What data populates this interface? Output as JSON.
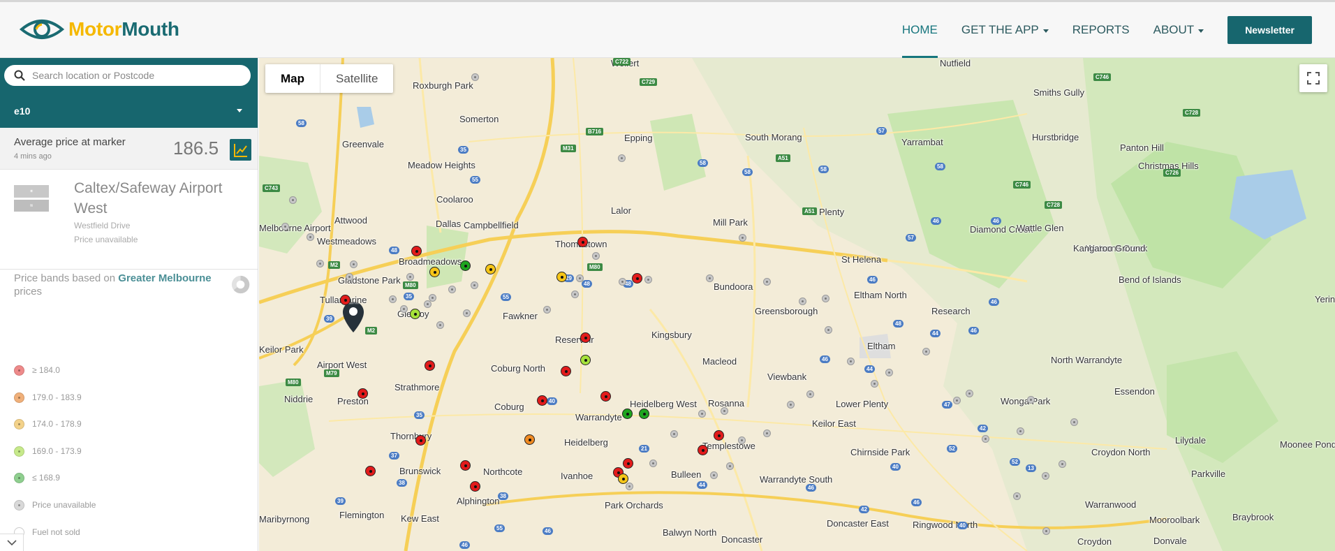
{
  "header": {
    "logo_motor": "Motor",
    "logo_mouth": "Mouth",
    "nav": [
      {
        "label": "HOME",
        "has_caret": false,
        "active": true
      },
      {
        "label": "GET THE APP",
        "has_caret": true,
        "active": false
      },
      {
        "label": "REPORTS",
        "has_caret": false,
        "active": false
      },
      {
        "label": "ABOUT",
        "has_caret": true,
        "active": false
      }
    ],
    "newsletter_label": "Newsletter"
  },
  "sidebar": {
    "search_placeholder": "Search location or Postcode",
    "fuel_type": "e10",
    "avg_label": "Average price at marker",
    "avg_time": "4 mins ago",
    "avg_price": "186.5",
    "station": {
      "name": "Caltex/Safeway Airport West",
      "address": "Westfield Drive",
      "status": "Price unavailable"
    },
    "bands_prefix": "Price bands based on",
    "bands_city": "Greater Melbourne",
    "bands_suffix": "prices",
    "legend": [
      {
        "label": "≥ 184.0",
        "color": "#ee8a8a"
      },
      {
        "label": "179.0 - 183.9",
        "color": "#f0b07a"
      },
      {
        "label": "174.0 - 178.9",
        "color": "#f3d28a"
      },
      {
        "label": "169.0 - 173.9",
        "color": "#c6e98a"
      },
      {
        "label": "≤ 168.9",
        "color": "#8fcf8f"
      },
      {
        "label": "Price unavailable",
        "color": "#d9d9d9"
      },
      {
        "label": "Fuel not sold",
        "color": "#ffffff"
      }
    ]
  },
  "map": {
    "toggle_map": "Map",
    "toggle_satellite": "Satellite",
    "colors": {
      "red": "#e21b1b",
      "orange": "#ef8a22",
      "yellow": "#f5c518",
      "lime": "#a6e23a",
      "green": "#1fa51f"
    },
    "places": [
      "Wollert",
      "Nutfield",
      "Roxburgh Park",
      "Somerton",
      "Smiths Gully",
      "Greenvale",
      "Epping",
      "South Morang",
      "Yarrambat",
      "Hurstbridge",
      "Panton Hill",
      "Christmas Hills",
      "Meadow Heights",
      "Coolaroo",
      "Dallas",
      "Campbellfield",
      "Lalor",
      "Mill Park",
      "Plenty",
      "Diamond Creek",
      "Wattle Glen",
      "Watsons Creek",
      "Melbourne Airport",
      "Attwood",
      "Westmeadows",
      "Thomastown",
      "Broadmeadows",
      "St Helena",
      "Kangaroo Ground",
      "Bend of Islands",
      "Yering",
      "Gladstone Park",
      "Bundoora",
      "Eltham North",
      "Tullamarine",
      "Glenroy",
      "Fawkner",
      "Greensborough",
      "Research",
      "Keilor Park",
      "Reservoir",
      "Kingsbury",
      "Eltham",
      "Airport West",
      "Coburg North",
      "Macleod",
      "Viewbank",
      "North Warrandyte",
      "Strathmore",
      "Coburg",
      "Heidelberg West",
      "Rosanna",
      "Lower Plenty",
      "Keilor East",
      "Niddrie",
      "Preston",
      "Warrandyte",
      "Wonga Park",
      "Essendon",
      "Thornbury",
      "Heidelberg",
      "Templestowe",
      "Chirnside Park",
      "Lilydale",
      "Moonee Ponds",
      "Brunswick",
      "Northcote",
      "Ivanhoe",
      "Bulleen",
      "Warrandyte South",
      "Croydon North",
      "Parkville",
      "Alphington",
      "Park Orchards",
      "Warranwood",
      "Mooroolbark",
      "Braybrook",
      "Maribyrnong",
      "Flemington",
      "Kew East",
      "Balwyn North",
      "Doncaster",
      "Doncaster East",
      "Ringwood North",
      "Croydon",
      "Donvale"
    ]
  }
}
